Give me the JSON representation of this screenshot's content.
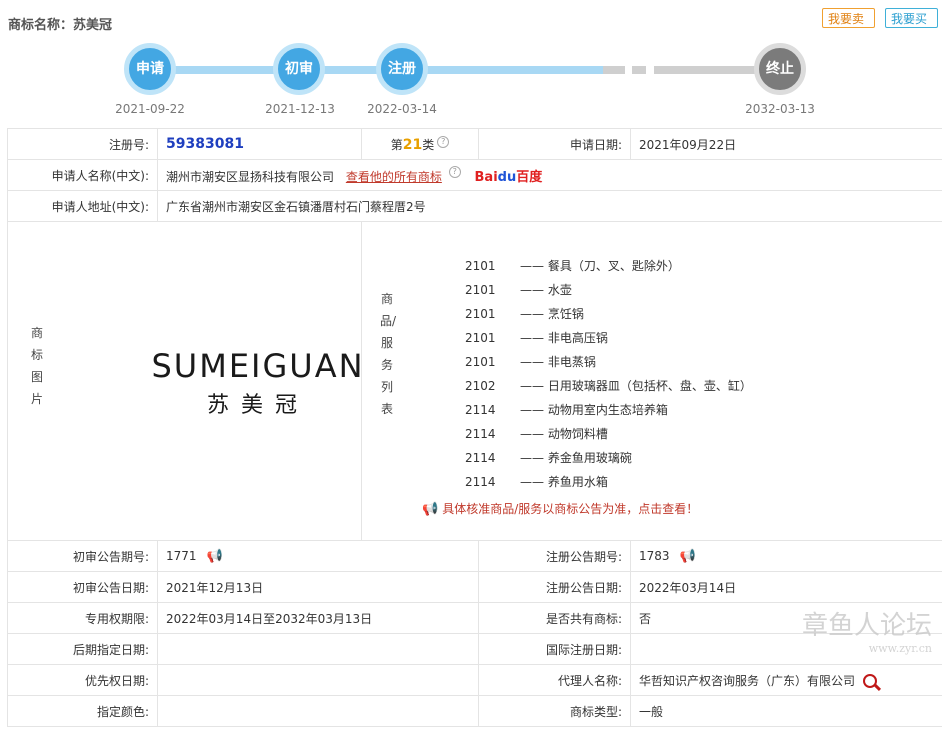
{
  "header": {
    "title": "商标名称：苏美冠",
    "sell_label": "我要卖",
    "buy_label": "我要买"
  },
  "timeline": [
    {
      "label": "申请",
      "date": "2021-09-22"
    },
    {
      "label": "初审",
      "date": "2021-12-13"
    },
    {
      "label": "注册",
      "date": "2022-03-14"
    },
    {
      "label": "终止",
      "date": "2032-03-13"
    }
  ],
  "info": {
    "reg_no_label": "注册号:",
    "reg_no": "59383081",
    "class_prefix": "第",
    "class_num": "21",
    "class_suffix": "类",
    "apply_date_label": "申请日期:",
    "apply_date": "2021年09月22日",
    "applicant_label": "申请人名称(中文):",
    "applicant": "潮州市潮安区显扬科技有限公司",
    "all_marks_link": "查看他的所有商标",
    "baidu_text": "Bai",
    "baidu_paw": "du",
    "baidu_cn": "百度",
    "address_label": "申请人地址(中文):",
    "address": "广东省潮州市潮安区金石镇潘厝村石门蔡程厝2号",
    "image_label": "商标图片",
    "logo_en": "SUMEIGUAN",
    "logo_cn": "苏美冠",
    "goods_label": "商品/服务列表",
    "goods": [
      {
        "code": "2101",
        "name": "餐具（刀、叉、匙除外）"
      },
      {
        "code": "2101",
        "name": "水壶"
      },
      {
        "code": "2101",
        "name": "烹饪锅"
      },
      {
        "code": "2101",
        "name": "非电高压锅"
      },
      {
        "code": "2101",
        "name": "非电蒸锅"
      },
      {
        "code": "2102",
        "name": "日用玻璃器皿（包括杯、盘、壶、缸）"
      },
      {
        "code": "2114",
        "name": "动物用室内生态培养箱"
      },
      {
        "code": "2114",
        "name": "动物饲料槽"
      },
      {
        "code": "2114",
        "name": "养金鱼用玻璃碗"
      },
      {
        "code": "2114",
        "name": "养鱼用水箱"
      }
    ],
    "goods_notice": "具体核准商品/服务以商标公告为准，点击查看！",
    "prelim_no_label": "初审公告期号:",
    "prelim_no": "1771",
    "reg_pub_no_label": "注册公告期号:",
    "reg_pub_no": "1783",
    "prelim_date_label": "初审公告日期:",
    "prelim_date": "2021年12月13日",
    "reg_pub_date_label": "注册公告日期:",
    "reg_pub_date": "2022年03月14日",
    "exclusive_label": "专用权期限:",
    "exclusive": "2022年03月14日至2032年03月13日",
    "shared_label": "是否共有商标:",
    "shared": "否",
    "later_date_label": "后期指定日期:",
    "later_date": "",
    "intl_date_label": "国际注册日期:",
    "intl_date": "",
    "priority_label": "优先权日期:",
    "priority": "",
    "agent_label": "代理人名称:",
    "agent": "华哲知识产权咨询服务（广东）有限公司",
    "color_label": "指定颜色:",
    "color": "",
    "type_label": "商标类型:",
    "type": "一般"
  },
  "watermark": {
    "text": "章鱼人论坛",
    "url": "www.zyr.cn"
  },
  "colors": {
    "accent": "#43a7e3",
    "track": "#a8d8f4",
    "end_node": "#7b7b7b",
    "link_red": "#c0392b"
  }
}
